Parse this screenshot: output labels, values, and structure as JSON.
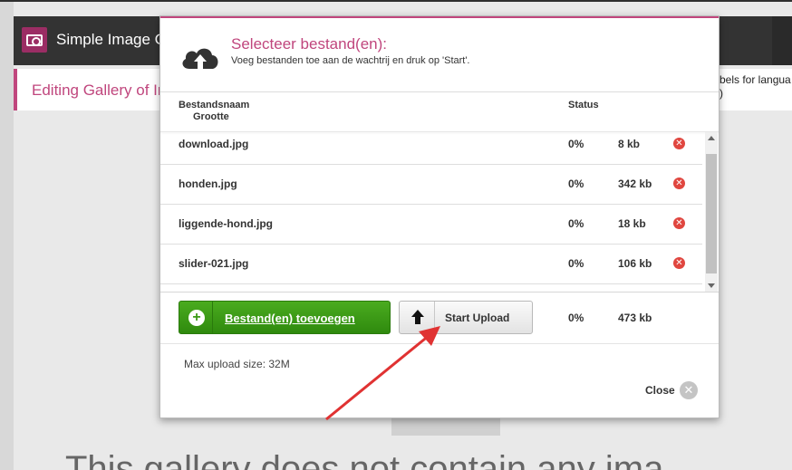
{
  "background": {
    "app_title": "Simple Image Gallery",
    "subtitle": "Editing Gallery of Images",
    "right_text_1": "bels for langua",
    "right_text_2": ")",
    "big_text": "This gallery does not contain any ima"
  },
  "dialog": {
    "title": "Selecteer bestand(en):",
    "subtitle": "Voeg bestanden toe aan de wachtrij en druk op 'Start'.",
    "columns": {
      "name": "Bestandsnaam",
      "size": "Grootte",
      "status": "Status"
    },
    "files": [
      {
        "name": "download.jpg",
        "status": "0%",
        "size": "8 kb"
      },
      {
        "name": "honden.jpg",
        "status": "0%",
        "size": "342 kb"
      },
      {
        "name": "liggende-hond.jpg",
        "status": "0%",
        "size": "18 kb"
      },
      {
        "name": "slider-021.jpg",
        "status": "0%",
        "size": "106 kb"
      }
    ],
    "add_button_label": "Bestand(en) toevoegen",
    "start_button_label": "Start Upload",
    "total_status": "0%",
    "total_size": "473 kb",
    "max_upload": "Max upload size: 32M",
    "close_label": "Close"
  },
  "colors": {
    "accent": "#c0467d",
    "add_button": "#3b9a16",
    "delete_icon": "#e0463f",
    "annotation_arrow": "#e03232"
  },
  "icons": {
    "upload": "cloud-upload-icon",
    "delete": "remove-icon",
    "add": "plus-circle-icon",
    "start": "arrow-up-icon",
    "close": "close-circle-icon",
    "logo": "camera-icon"
  }
}
